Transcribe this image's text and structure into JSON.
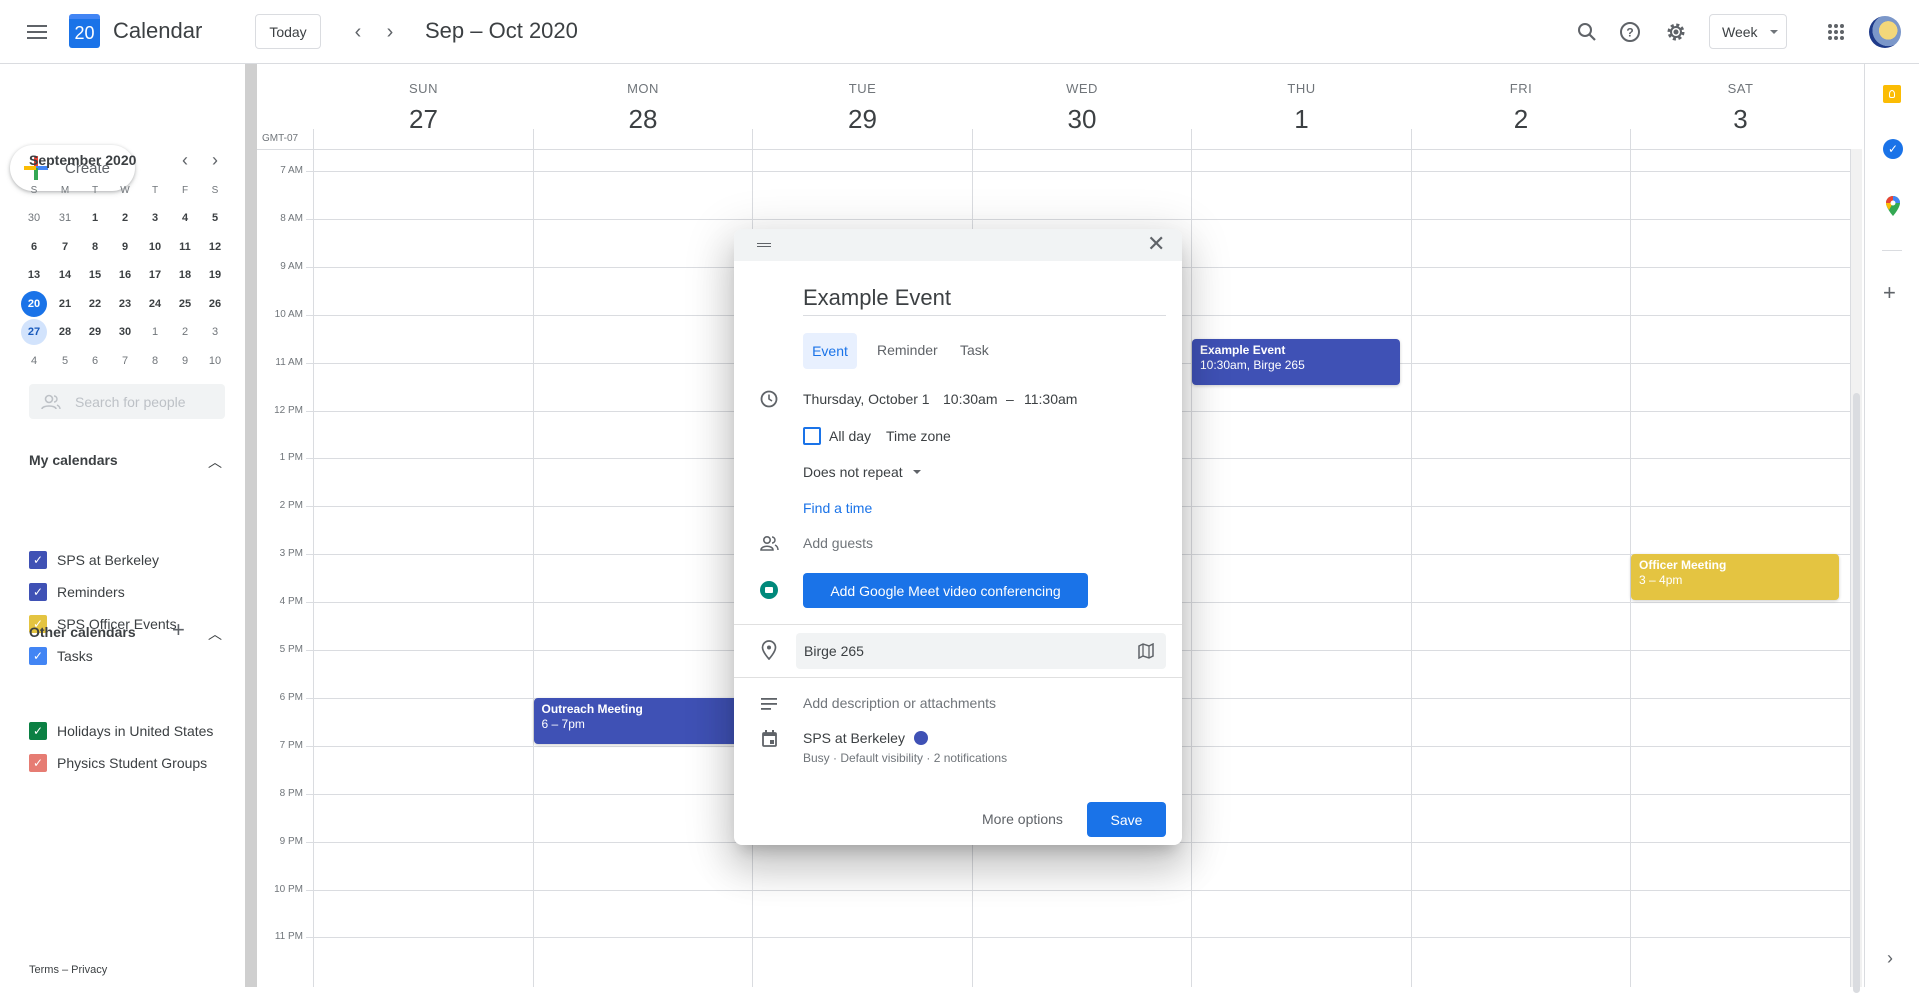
{
  "header": {
    "app_name": "Calendar",
    "logo_day": "20",
    "today_label": "Today",
    "date_range": "Sep – Oct 2020",
    "view_select": "Week",
    "icons": [
      "menu-icon",
      "search-icon",
      "help-icon",
      "settings-icon",
      "apps-icon",
      "avatar"
    ]
  },
  "sidebar": {
    "create_label": "Create",
    "mini_calendar": {
      "title": "September 2020",
      "weekdays": [
        "S",
        "M",
        "T",
        "W",
        "T",
        "F",
        "S"
      ],
      "weeks": [
        [
          30,
          31,
          1,
          2,
          3,
          4,
          5
        ],
        [
          6,
          7,
          8,
          9,
          10,
          11,
          12
        ],
        [
          13,
          14,
          15,
          16,
          17,
          18,
          19
        ],
        [
          20,
          21,
          22,
          23,
          24,
          25,
          26
        ],
        [
          27,
          28,
          29,
          30,
          1,
          2,
          3
        ],
        [
          4,
          5,
          6,
          7,
          8,
          9,
          10
        ]
      ],
      "today": 20,
      "selected": 27
    },
    "search_people_placeholder": "Search for people",
    "my_calendars": {
      "title": "My calendars",
      "items": [
        {
          "label": "SPS at Berkeley",
          "color": "#3f51b5",
          "checked": true
        },
        {
          "label": "Reminders",
          "color": "#3f51b5",
          "checked": true
        },
        {
          "label": "SPS Officer Events",
          "color": "#e4c441",
          "checked": true
        },
        {
          "label": "Tasks",
          "color": "#4285f4",
          "checked": true
        }
      ]
    },
    "other_calendars": {
      "title": "Other calendars",
      "items": [
        {
          "label": "Holidays in United States",
          "color": "#0b8043",
          "checked": true
        },
        {
          "label": "Physics Student Groups",
          "color": "#e67c73",
          "checked": true
        }
      ]
    },
    "footer": "Terms – Privacy"
  },
  "week": {
    "timezone": "GMT-07",
    "days": [
      {
        "dow": "SUN",
        "date": "27"
      },
      {
        "dow": "MON",
        "date": "28"
      },
      {
        "dow": "TUE",
        "date": "29"
      },
      {
        "dow": "WED",
        "date": "30"
      },
      {
        "dow": "THU",
        "date": "1"
      },
      {
        "dow": "FRI",
        "date": "2"
      },
      {
        "dow": "SAT",
        "date": "3"
      }
    ],
    "hours": [
      "7 AM",
      "8 AM",
      "9 AM",
      "10 AM",
      "11 AM",
      "12 PM",
      "1 PM",
      "2 PM",
      "3 PM",
      "4 PM",
      "5 PM",
      "6 PM",
      "7 PM",
      "8 PM",
      "9 PM",
      "10 PM",
      "11 PM"
    ],
    "events": [
      {
        "title": "Example Event",
        "detail": "10:30am, Birge 265",
        "day": 4,
        "start": 10.5,
        "end": 11.5,
        "color": "#3f51b5"
      },
      {
        "title": "Outreach Meeting",
        "detail": "6 – 7pm",
        "day": 1,
        "start": 18,
        "end": 19,
        "color": "#3f51b5"
      },
      {
        "title": "Officer Meeting",
        "detail": "3 – 4pm",
        "day": 6,
        "start": 15,
        "end": 16,
        "color": "#e4c441"
      }
    ]
  },
  "dialog": {
    "title_value": "Example Event",
    "tabs": [
      "Event",
      "Reminder",
      "Task"
    ],
    "active_tab": "Event",
    "date": "Thursday, October 1",
    "start_time": "10:30am",
    "dash": "–",
    "end_time": "11:30am",
    "all_day_label": "All day",
    "time_zone_label": "Time zone",
    "repeat": "Does not repeat",
    "find_time": "Find a time",
    "guests_placeholder": "Add guests",
    "meet_button": "Add Google Meet video conferencing",
    "location": "Birge 265",
    "description_placeholder": "Add description or attachments",
    "calendar_name": "SPS at Berkeley",
    "calendar_color": "#3f51b5",
    "calendar_details": "Busy · Default visibility · 2 notifications",
    "more_options": "More options",
    "save": "Save"
  }
}
